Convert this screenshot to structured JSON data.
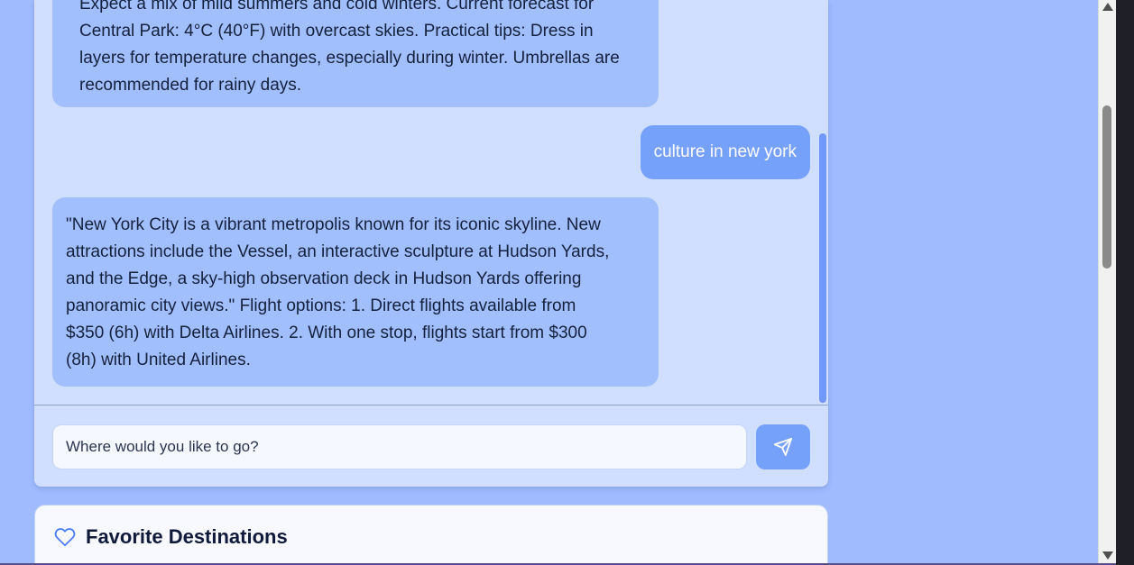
{
  "chat": {
    "messages": [
      {
        "role": "assistant",
        "text": "Expect a mix of mild summers and cold winters. Current forecast for\nCentral Park: 4°C (40°F) with overcast skies. Practical tips: Dress in\nlayers for temperature changes, especially during winter. Umbrellas are\nrecommended for rainy days."
      },
      {
        "role": "user",
        "text": "culture in new york"
      },
      {
        "role": "assistant",
        "text": "\"New York City is a vibrant metropolis known for its iconic skyline. New\nattractions include the Vessel, an interactive sculpture at Hudson Yards,\nand the Edge, a sky-high observation deck in Hudson Yards offering\npanoramic city views.\" Flight options: 1. Direct flights available from\n$350 (6h) with Delta Airlines. 2. With one stop, flights start from $300\n(8h) with United Airlines."
      }
    ],
    "input": {
      "value": "",
      "placeholder": "Where would you like to go?"
    },
    "send_icon": "send-icon"
  },
  "favorites": {
    "title": "Favorite Destinations",
    "icon": "heart-icon"
  },
  "colors": {
    "page_background": "#a0bcff",
    "chat_background": "#d0dfff",
    "assistant_bubble": "#a2bffd",
    "user_bubble": "#76a1fb",
    "send_button": "#76a1fb",
    "heart_outline": "#4a7df0"
  }
}
